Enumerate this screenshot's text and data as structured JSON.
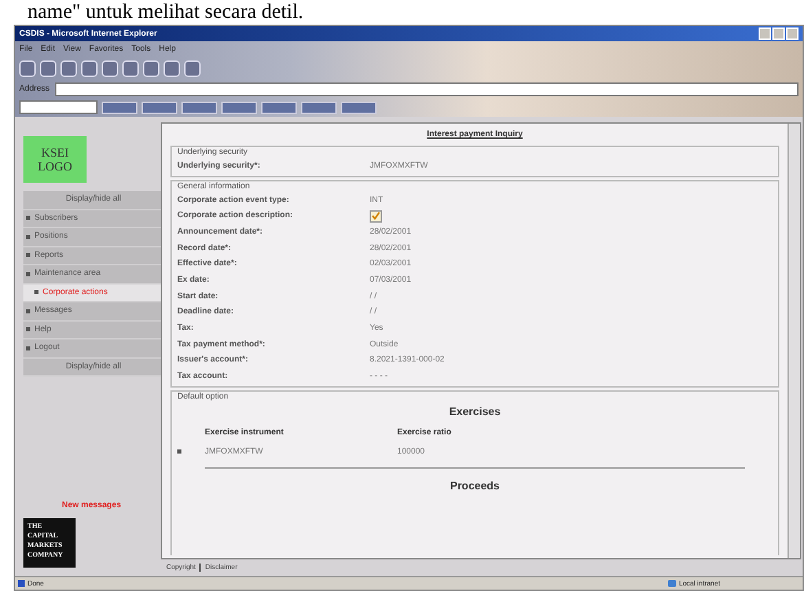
{
  "caption": "name\" untuk melihat secara detil.",
  "window": {
    "title": "CSDIS - Microsoft Internet Explorer"
  },
  "menu": [
    "File",
    "Edit",
    "View",
    "Favorites",
    "Tools",
    "Help"
  ],
  "address": {
    "label": "Address"
  },
  "status_bar": {
    "left": "Done",
    "zone": "Local intranet"
  },
  "sidebar": {
    "logo": "KSEI LOGO",
    "items": [
      {
        "label": "Display/hide all",
        "kind": "toggle",
        "selected": false
      },
      {
        "label": "Subscribers",
        "kind": "link",
        "selected": false
      },
      {
        "label": "Positions",
        "kind": "link",
        "selected": false
      },
      {
        "label": "Reports",
        "kind": "link",
        "selected": false
      },
      {
        "label": "Maintenance area",
        "kind": "link",
        "selected": false
      },
      {
        "label": "Corporate actions",
        "kind": "sub",
        "selected": true
      },
      {
        "label": "Messages",
        "kind": "link",
        "selected": false
      },
      {
        "label": "Help",
        "kind": "link",
        "selected": false
      },
      {
        "label": "Logout",
        "kind": "link",
        "selected": false
      },
      {
        "label": "Display/hide all",
        "kind": "toggle",
        "selected": false
      }
    ],
    "new_messages": "New messages",
    "company_logo": "THE CAPITAL MARKETS COMPANY"
  },
  "page": {
    "title": "Interest payment Inquiry",
    "sections": [
      {
        "legend": "Underlying security",
        "fields": [
          {
            "label": "Underlying security*:",
            "kind": "text",
            "value": "JMFOXMXFTW"
          }
        ]
      },
      {
        "legend": "General information",
        "fields": [
          {
            "label": "Corporate action event type:",
            "kind": "text",
            "value": "INT"
          },
          {
            "label": "Corporate action description:",
            "kind": "checkbox",
            "checked": true
          },
          {
            "label": "Announcement date*:",
            "kind": "text",
            "value": "28/02/2001"
          },
          {
            "label": "Record date*:",
            "kind": "text",
            "value": "28/02/2001"
          },
          {
            "label": "Effective date*:",
            "kind": "text",
            "value": "02/03/2001"
          },
          {
            "label": "Ex date:",
            "kind": "text",
            "value": "07/03/2001"
          },
          {
            "label": "Start date:",
            "kind": "text",
            "value": "/ /"
          },
          {
            "label": "Deadline date:",
            "kind": "text",
            "value": "/ /"
          },
          {
            "label": "Tax:",
            "kind": "text",
            "value": "Yes"
          },
          {
            "label": "Tax payment method*:",
            "kind": "text",
            "value": "Outside"
          },
          {
            "label": "Issuer's account*:",
            "kind": "text",
            "value": "8.2021-1391-000-02"
          },
          {
            "label": "Tax account:",
            "kind": "text",
            "value": "- - - -"
          }
        ]
      }
    ],
    "default_option": {
      "legend": "Default option",
      "exercises_title": "Exercises",
      "columns": [
        "Exercise instrument",
        "Exercise ratio"
      ],
      "rows": [
        [
          "JMFOXMXFTW",
          "100000"
        ]
      ],
      "proceeds_title": "Proceeds"
    },
    "footer": [
      "Copyright",
      "Disclaimer"
    ]
  }
}
